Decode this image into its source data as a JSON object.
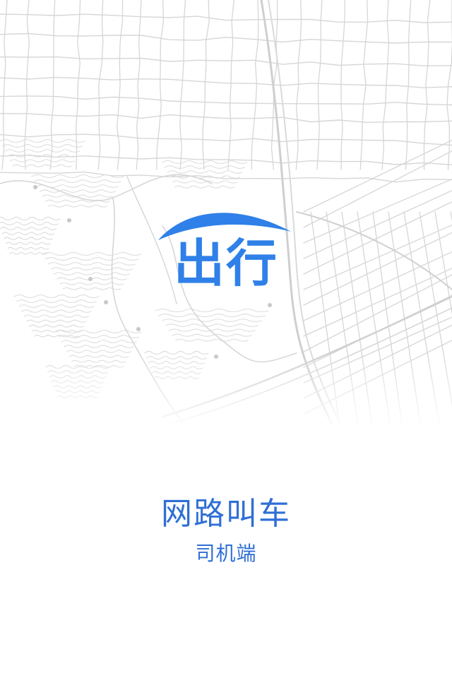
{
  "splash": {
    "logo_text": "出行",
    "app_title": "网路叫车",
    "app_subtitle": "司机端",
    "brand_color": "#2f80e8",
    "title_color": "#2f6fd6",
    "map_line_color": "#d6d6d6",
    "map_icon": "city-map-illustration",
    "logo_icon": "car-roof-arc-icon"
  }
}
